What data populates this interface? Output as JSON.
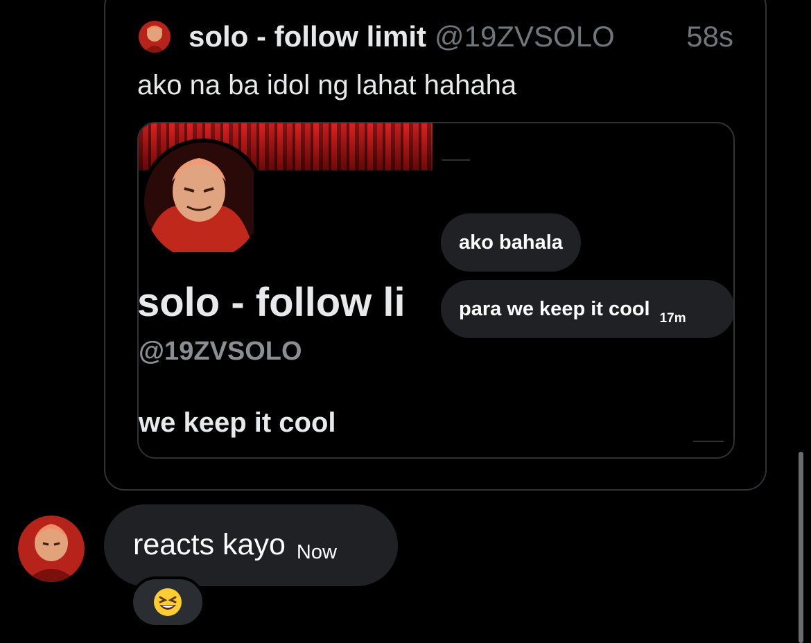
{
  "quoted_tweet": {
    "author_name": "solo - follow limit",
    "handle": "@19ZVSOLO",
    "time": "58s",
    "text": "ako na ba idol ng lahat hahaha",
    "media": {
      "profile_name": "solo - follow li",
      "profile_handle": "@19ZVSOLO",
      "profile_bio": "we keep it cool",
      "dm_messages": [
        {
          "text": "ako bahala"
        },
        {
          "text": "para we keep it cool",
          "time": "17m"
        }
      ]
    }
  },
  "message": {
    "text": "reacts kayo",
    "time": "Now",
    "reaction": "😆"
  },
  "icons": {
    "avatar": "anime-character-avatar-icon"
  },
  "colors": {
    "background": "#000000",
    "bubble": "#1f2125",
    "border": "#2f3336",
    "muted_text": "#71767b"
  }
}
